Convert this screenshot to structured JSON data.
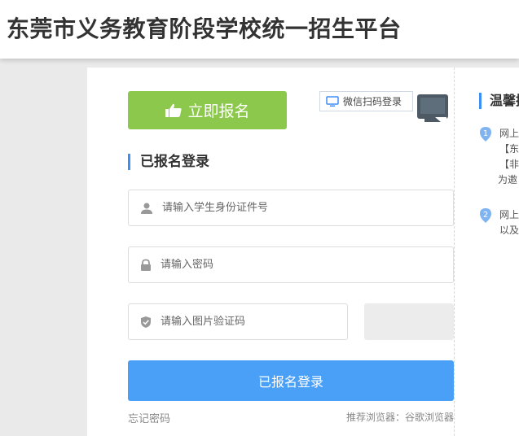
{
  "header": {
    "title": "东莞市义务教育阶段学校统一招生平台"
  },
  "register_button": {
    "label": "立即报名"
  },
  "qr_login": {
    "label": "微信扫码登录"
  },
  "login_section": {
    "title": "已报名登录",
    "id_placeholder": "请输入学生身份证件号",
    "password_placeholder": "请输入密码",
    "captcha_placeholder": "请输入图片验证码",
    "login_button": "已报名登录",
    "forgot_password": "忘记密码",
    "browser_tip": "推荐浏览器：谷歌浏览器"
  },
  "tips": {
    "title": "温馨提",
    "items": [
      {
        "number": "1",
        "line": "网上",
        "subs": [
          "【东",
          "【非",
          "为邀"
        ]
      },
      {
        "number": "2",
        "line": "网上",
        "subs": [
          "以及"
        ]
      }
    ]
  },
  "colors": {
    "register_green": "#8cc84b",
    "login_blue": "#4a9ff6",
    "accent_blue": "#3e8ef7"
  }
}
